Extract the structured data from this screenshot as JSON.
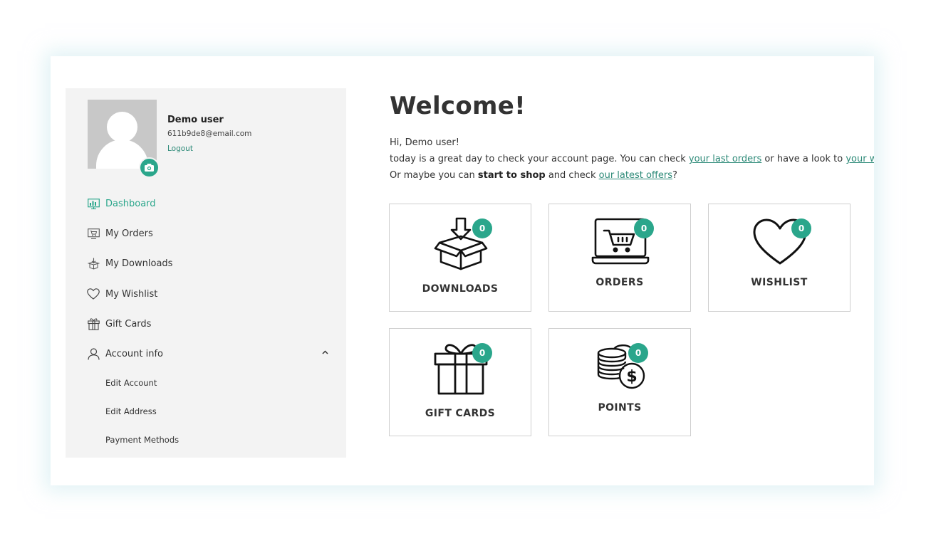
{
  "user": {
    "name": "Demo user",
    "email": "611b9de8@email.com",
    "logout_label": "Logout"
  },
  "sidebar": {
    "items": [
      {
        "label": "Dashboard",
        "icon": "dashboard-icon",
        "active": true
      },
      {
        "label": "My Orders",
        "icon": "orders-icon"
      },
      {
        "label": "My Downloads",
        "icon": "downloads-icon"
      },
      {
        "label": "My Wishlist",
        "icon": "heart-icon"
      },
      {
        "label": "Gift Cards",
        "icon": "gift-icon"
      },
      {
        "label": "Account info",
        "icon": "user-icon",
        "expanded": true
      }
    ],
    "sub_items": [
      "Edit Account",
      "Edit Address",
      "Payment Methods"
    ]
  },
  "main": {
    "title": "Welcome!",
    "greeting": "Hi, Demo user!",
    "line2_prefix": "today is a great day to check your account page. You can check ",
    "line2_link1": "your last orders",
    "line2_middle": " or have a look to ",
    "line2_link2": "your wish",
    "line3_prefix": "Or maybe you can ",
    "line3_bold": "start to shop",
    "line3_middle": " and check ",
    "line3_link": "our latest offers",
    "line3_suffix": "?"
  },
  "tiles": [
    {
      "label": "DOWNLOADS",
      "count": "0",
      "icon": "download-box-icon"
    },
    {
      "label": "ORDERS",
      "count": "0",
      "icon": "laptop-cart-icon"
    },
    {
      "label": "WISHLIST",
      "count": "0",
      "icon": "heart-icon"
    },
    {
      "label": "GIFT CARDS",
      "count": "0",
      "icon": "gift-box-icon"
    },
    {
      "label": "POINTS",
      "count": "0",
      "icon": "coins-icon"
    }
  ],
  "colors": {
    "accent": "#2aa68b",
    "link": "#2d8a78",
    "sidebar_bg": "#f3f3f3"
  }
}
